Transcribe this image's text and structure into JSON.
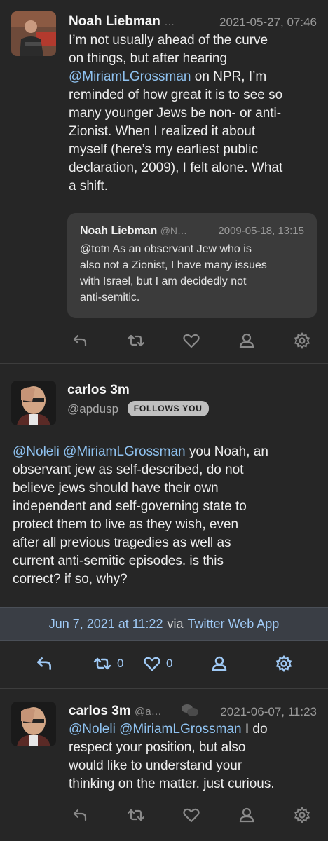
{
  "tweet1": {
    "author": "Noah Liebman",
    "handle_trunc": "…",
    "timestamp": "2021-05-27, 07:46",
    "lines": [
      "I’m not usually ahead of the curve",
      "on things, but after hearing",
      [
        "@MiriamLGrossman",
        " on NPR, I’m"
      ],
      "reminded of how great it is to see so",
      "many younger Jews be non- or anti-",
      "Zionist. When I realized it about",
      "myself (here’s my earliest public",
      "declaration, 2009), I felt alone. What",
      "a shift."
    ],
    "quote": {
      "author": "Noah Liebman",
      "handle": "@N…",
      "timestamp": "2009-05-18, 13:15",
      "lines": [
        "@totn As an observant Jew who is",
        "also not a Zionist, I have many issues",
        "with Israel, but I am decidedly not",
        "anti-semitic."
      ]
    }
  },
  "tweet2": {
    "author": "carlos 3m",
    "handle": "@apdusp",
    "badge": "FOLLOWS YOU",
    "line1_mentions": [
      "@Noleli",
      "@MiriamLGrossman"
    ],
    "line1_rest": " you Noah, an",
    "lines": [
      "observant jew as self-described, do not",
      "believe jews should have their own",
      "independent and self-governing state to",
      "protect them to live as they wish, even",
      "after all previous tragedies as well as",
      "current anti-semitic episodes. is this",
      "correct? if so, why?"
    ],
    "date_link": "Jun 7, 2021 at 11:22",
    "via": "via",
    "client": "Twitter Web App",
    "retweet_count": "0",
    "like_count": "0"
  },
  "tweet3": {
    "author": "carlos 3m",
    "handle_trunc": "@a…",
    "timestamp": "2021-06-07, 11:23",
    "line1_mentions": [
      "@Noleli",
      "@MiriamLGrossman"
    ],
    "line1_rest": " I do",
    "lines": [
      "respect your position, but also",
      "would like to understand your",
      "thinking on the matter. just curious."
    ]
  },
  "colors": {
    "background": "#262626",
    "mention": "#8fc2f0",
    "action_icon": "#8a8a8a",
    "action_icon_active": "#9fc9f5",
    "quote_bg": "#3b3b3b"
  },
  "icons": [
    "reply-icon",
    "retweet-icon",
    "like-icon",
    "profile-icon",
    "gear-icon",
    "conversation-icon"
  ]
}
